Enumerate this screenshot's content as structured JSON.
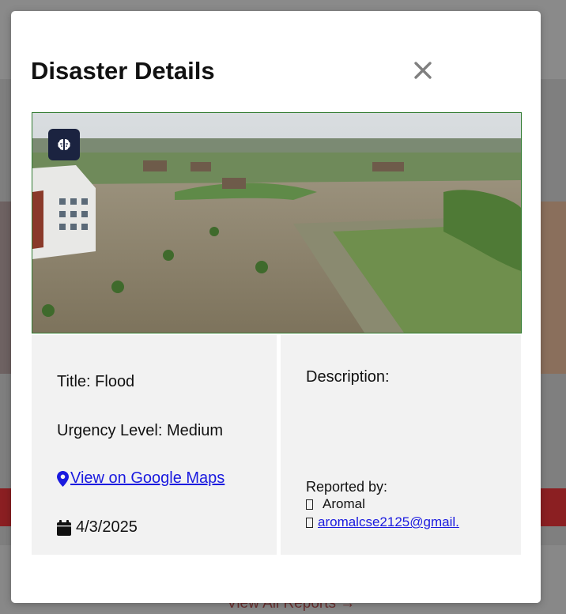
{
  "background": {
    "view_all_label": "View All Reports →"
  },
  "modal": {
    "title": "Disaster Details",
    "close_icon": "close-icon",
    "image_badge_icon": "brain-icon"
  },
  "details": {
    "title_text": "Title: Flood",
    "urgency_text": "Urgency Level: Medium",
    "maps_icon": "map-pin-icon",
    "maps_link_label": " View on Google Maps",
    "date_icon": "calendar-icon",
    "date": "4/3/2025"
  },
  "meta": {
    "description_label": "Description:",
    "reported_by_label": "Reported by:",
    "reporter_name": "Aromal",
    "reporter_email": "aromalcse2125@gmail."
  }
}
